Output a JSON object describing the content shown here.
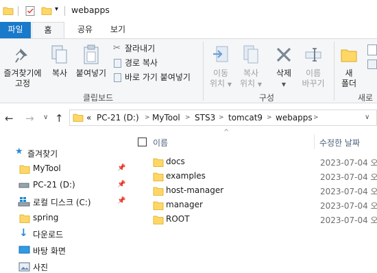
{
  "window": {
    "title": "webapps"
  },
  "tabs": [
    {
      "label": "파일"
    },
    {
      "label": "홈"
    },
    {
      "label": "공유"
    },
    {
      "label": "보기"
    }
  ],
  "ribbon": {
    "pin_quick_access": "즐겨찾기에\n고정",
    "pin_line1": "즐겨찾기에",
    "pin_line2": "고정",
    "copy": "복사",
    "paste": "붙여넣기",
    "cut": "잘라내기",
    "copy_path": "경로 복사",
    "paste_shortcut": "바로 가기 붙여넣기",
    "clipboard_group": "클립보드",
    "move_to_line1": "이동",
    "move_to_line2": "위치",
    "copy_to_line1": "복사",
    "copy_to_line2": "위치",
    "delete": "삭제",
    "rename_line1": "이름",
    "rename_line2": "바꾸기",
    "organize_group": "구성",
    "new_folder_line1": "새",
    "new_folder_line2": "폴더",
    "new_group": "새로"
  },
  "address": {
    "overflow": "«",
    "crumbs": [
      "PC-21 (D:)",
      "MyTool",
      "STS3",
      "tomcat9",
      "webapps"
    ]
  },
  "navpane": {
    "items": [
      {
        "label": "즐겨찾기",
        "icon": "star-icon",
        "pinned": false
      },
      {
        "label": "MyTool",
        "icon": "folder-icon",
        "pinned": true
      },
      {
        "label": "PC-21 (D:)",
        "icon": "drive-icon",
        "pinned": true
      },
      {
        "label": "로컬 디스크 (C:)",
        "icon": "windows-drive-icon",
        "pinned": true
      },
      {
        "label": "spring",
        "icon": "folder-icon",
        "pinned": false
      },
      {
        "label": "다운로드",
        "icon": "download-icon",
        "pinned": false
      },
      {
        "label": "바탕 화면",
        "icon": "desktop-icon",
        "pinned": false
      },
      {
        "label": "사진",
        "icon": "pictures-icon",
        "pinned": false
      }
    ]
  },
  "filelist": {
    "col_name": "이름",
    "col_modified": "수정한 날짜",
    "rows": [
      {
        "name": "docs",
        "date": "2023-07-04 오"
      },
      {
        "name": "examples",
        "date": "2023-07-04 오"
      },
      {
        "name": "host-manager",
        "date": "2023-07-04 오"
      },
      {
        "name": "manager",
        "date": "2023-07-04 오"
      },
      {
        "name": "ROOT",
        "date": "2023-07-04 오"
      }
    ]
  },
  "colors": {
    "accent": "#1979ca",
    "folder": "#ffd766",
    "ribbon_bg": "#f5f6f7"
  }
}
